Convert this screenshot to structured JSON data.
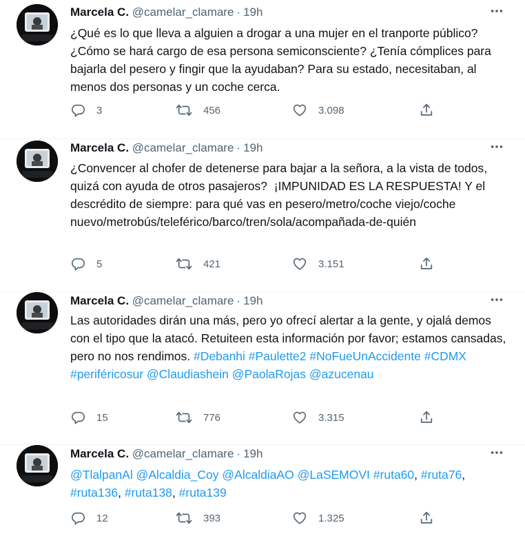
{
  "tweets": [
    {
      "name": "Marcela C.",
      "handle": "@camelar_clamare",
      "time": "19h",
      "body": [
        {
          "t": "¿Qué es lo que lleva a alguien a drogar a una mujer en el tranporte público? ¿Cómo se hará cargo de esa persona semiconsciente? ¿Tenía cómplices para bajarla del pesero y fingir que la ayudaban? Para su estado, necesitaban, al menos dos personas y un coche cerca.",
          "link": false
        }
      ],
      "replies": "3",
      "retweets": "456",
      "likes": "3.098"
    },
    {
      "name": "Marcela C.",
      "handle": "@camelar_clamare",
      "time": "19h",
      "body": [
        {
          "t": "¿Convencer al chofer de detenerse para bajar a la señora, a la vista de todos, quizá con ayuda de otros pasajeros?  ¡IMPUNIDAD ES LA RESPUESTA! Y el descrédito de siempre: para qué vas en pesero/metro/coche viejo/coche nuevo/metrobús/teleférico/barco/tren/sola/acompañada-de-quién",
          "link": false
        }
      ],
      "replies": "5",
      "retweets": "421",
      "likes": "3.151"
    },
    {
      "name": "Marcela C.",
      "handle": "@camelar_clamare",
      "time": "19h",
      "body": [
        {
          "t": "Las autoridades dirán una más, pero yo ofrecí alertar a la gente, y ojalá demos con el tipo que la atacó. Retuiteen esta información por favor; estamos cansadas, pero no nos rendimos. ",
          "link": false
        },
        {
          "t": "#Debanhi",
          "link": true
        },
        {
          "t": " ",
          "link": false
        },
        {
          "t": "#Paulette2",
          "link": true
        },
        {
          "t": " ",
          "link": false
        },
        {
          "t": "#NoFueUnAccidente",
          "link": true
        },
        {
          "t": " ",
          "link": false
        },
        {
          "t": "#CDMX",
          "link": true
        },
        {
          "t": " ",
          "link": false
        },
        {
          "t": "#periféricosur",
          "link": true
        },
        {
          "t": " ",
          "link": false
        },
        {
          "t": "@Claudiashein",
          "link": true
        },
        {
          "t": " ",
          "link": false
        },
        {
          "t": "@PaolaRojas",
          "link": true
        },
        {
          "t": " ",
          "link": false
        },
        {
          "t": "@azucenau",
          "link": true
        }
      ],
      "replies": "15",
      "retweets": "776",
      "likes": "3.315"
    },
    {
      "name": "Marcela C.",
      "handle": "@camelar_clamare",
      "time": "19h",
      "body": [
        {
          "t": "@TlalpanAl",
          "link": true
        },
        {
          "t": " ",
          "link": false
        },
        {
          "t": "@Alcaldia_Coy",
          "link": true
        },
        {
          "t": " ",
          "link": false
        },
        {
          "t": "@AlcaldiaAO",
          "link": true
        },
        {
          "t": " ",
          "link": false
        },
        {
          "t": "@LaSEMOVI",
          "link": true
        },
        {
          "t": " ",
          "link": false
        },
        {
          "t": "#ruta60",
          "link": true
        },
        {
          "t": ", ",
          "link": false
        },
        {
          "t": "#ruta76",
          "link": true
        },
        {
          "t": ", ",
          "link": false
        },
        {
          "t": "#ruta136",
          "link": true
        },
        {
          "t": ", ",
          "link": false
        },
        {
          "t": "#ruta138",
          "link": true
        },
        {
          "t": ", ",
          "link": false
        },
        {
          "t": "#ruta139",
          "link": true
        }
      ],
      "replies": "12",
      "retweets": "393",
      "likes": "1.325"
    }
  ],
  "colors": {
    "link": "#1d9bf0",
    "secondary_text": "#536471",
    "primary_text": "#0f1419",
    "divider": "#eff3f4"
  },
  "icons": {
    "more": "more-dots-icon",
    "reply": "reply-bubble-icon",
    "retweet": "retweet-arrows-icon",
    "like": "heart-icon",
    "share": "share-upload-icon"
  }
}
